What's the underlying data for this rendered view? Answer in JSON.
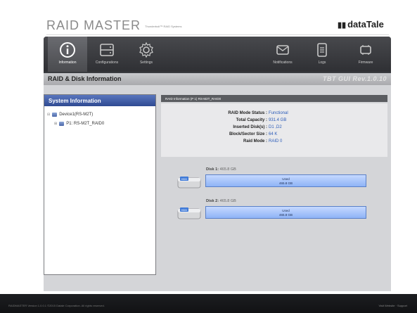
{
  "header": {
    "app_title": "RAID MASTER",
    "app_subtitle": "Thunderbolt™ RAID Systems",
    "brand": "dataTale",
    "brand_mark": "▮▮"
  },
  "nav": {
    "items": [
      {
        "label": "Information",
        "icon": "info-icon",
        "active": true
      },
      {
        "label": "Configurations",
        "icon": "drive-bay-icon",
        "active": false
      },
      {
        "label": "Settings",
        "icon": "gear-icon",
        "active": false
      },
      {
        "label": "Notifications",
        "icon": "envelope-icon",
        "active": false
      },
      {
        "label": "Logs",
        "icon": "document-icon",
        "active": false
      },
      {
        "label": "Firmware",
        "icon": "chip-icon",
        "active": false
      }
    ]
  },
  "section": {
    "title": "RAID & Disk Information",
    "version": "TBT GUI Rev.1.0.10"
  },
  "system_panel": {
    "title": "System Information",
    "tree": [
      {
        "label": "Device1(RS-M2T)",
        "toggle": "⊟"
      },
      {
        "label": "P1: RS-M2T_RAID0",
        "toggle": "⊞"
      }
    ]
  },
  "raid": {
    "header": "RAID Information (P 1) RS-M2T_RAID0",
    "rows": [
      {
        "key": "RAID Mode Status :",
        "value": "Functional"
      },
      {
        "key": "Total Capacity :",
        "value": "931.4 GB"
      },
      {
        "key": "Inserted Disk(s) :",
        "value": "D1 ,D2"
      },
      {
        "key": "Block/Sector Size :",
        "value": "64 K"
      },
      {
        "key": "Raid Mode :",
        "value": "RAID 0"
      }
    ]
  },
  "disks": [
    {
      "label": "Disk 1:",
      "size": "465.8 GB",
      "used_label": "Used",
      "used_value": "465.8 GB",
      "icon_text": "HDD",
      "used_fraction": 1.0
    },
    {
      "label": "Disk 2:",
      "size": "465.8 GB",
      "used_label": "Used",
      "used_value": "465.8 GB",
      "icon_text": "HDD",
      "used_fraction": 1.0
    }
  ],
  "footer": {
    "left": "RAIDMASTER Version 1.0.0.1 ©2015 Datale Corporation. All rights reserved.",
    "right": "Visit Website · Support"
  },
  "colors": {
    "accent": "#2f4a92",
    "value_text": "#2b5bb8",
    "disk_bar": "#8eb3f6"
  }
}
